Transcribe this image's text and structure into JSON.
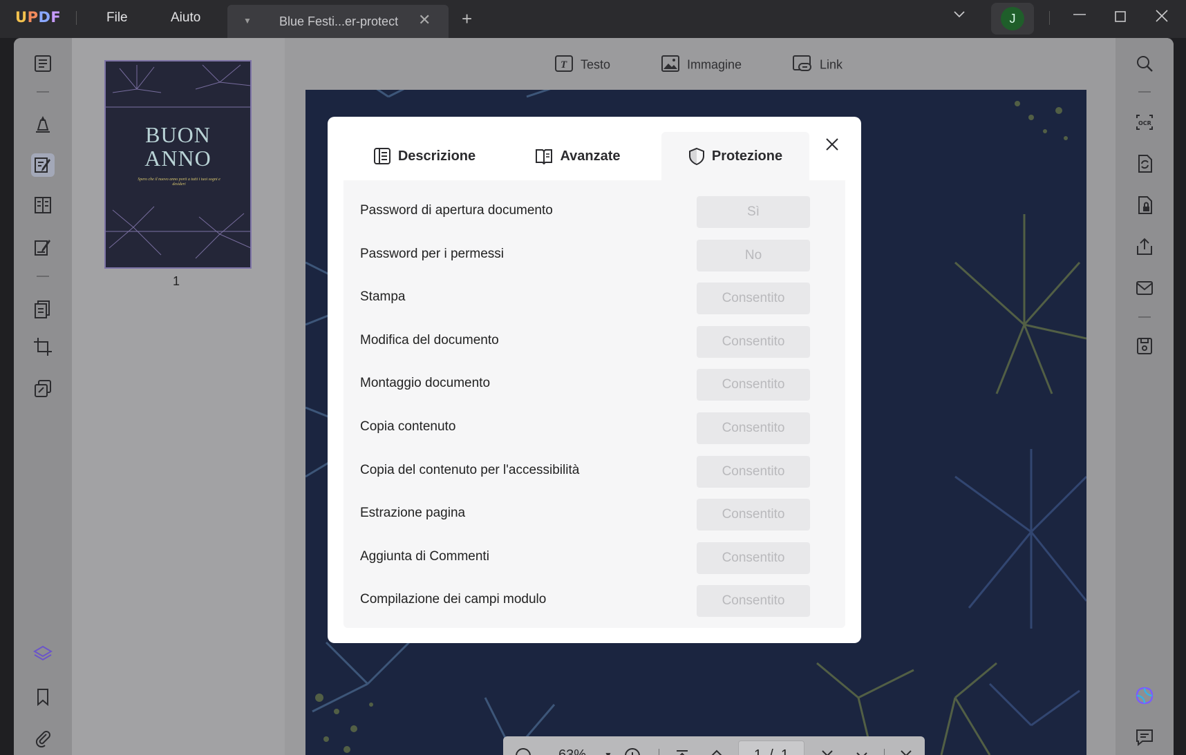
{
  "app": {
    "logo": [
      "U",
      "P",
      "D",
      "F"
    ],
    "menu": [
      "File",
      "Aiuto"
    ],
    "tab_title": "Blue Festi...er-protect",
    "avatar_initial": "J"
  },
  "toolbar": {
    "text_label": "Testo",
    "image_label": "Immagine",
    "link_label": "Link"
  },
  "thumbnail": {
    "line1": "BUON",
    "line2": "ANNO",
    "tagline": "Spero che il nuovo anno porti a tutti i tuoi sogni e desideri",
    "page_number": "1"
  },
  "dialog": {
    "tabs": [
      {
        "label": "Descrizione",
        "icon": "description-icon"
      },
      {
        "label": "Avanzate",
        "icon": "book-icon"
      },
      {
        "label": "Protezione",
        "icon": "shield-icon"
      }
    ],
    "active_tab": "Protezione",
    "rows": [
      {
        "label": "Password di apertura documento",
        "value": "Sì"
      },
      {
        "label": "Password per i permessi",
        "value": "No"
      },
      {
        "label": "Stampa",
        "value": "Consentito"
      },
      {
        "label": "Modifica del documento",
        "value": "Consentito"
      },
      {
        "label": "Montaggio documento",
        "value": "Consentito"
      },
      {
        "label": "Copia contenuto",
        "value": "Consentito"
      },
      {
        "label": "Copia del contenuto per l'accessibilità",
        "value": "Consentito"
      },
      {
        "label": "Estrazione pagina",
        "value": "Consentito"
      },
      {
        "label": "Aggiunta di Commenti",
        "value": "Consentito"
      },
      {
        "label": "Compilazione dei campi modulo",
        "value": "Consentito"
      }
    ]
  },
  "navigation": {
    "zoom": "63%",
    "current_page": "1",
    "page_sep": "/",
    "total_pages": "1"
  },
  "colors": {
    "page_background": "#1b2540",
    "dialog_background": "#ffffff",
    "panel_background": "#f6f6f7",
    "value_disabled_text": "#b9b9bc",
    "avatar": "#1f5e2a"
  }
}
